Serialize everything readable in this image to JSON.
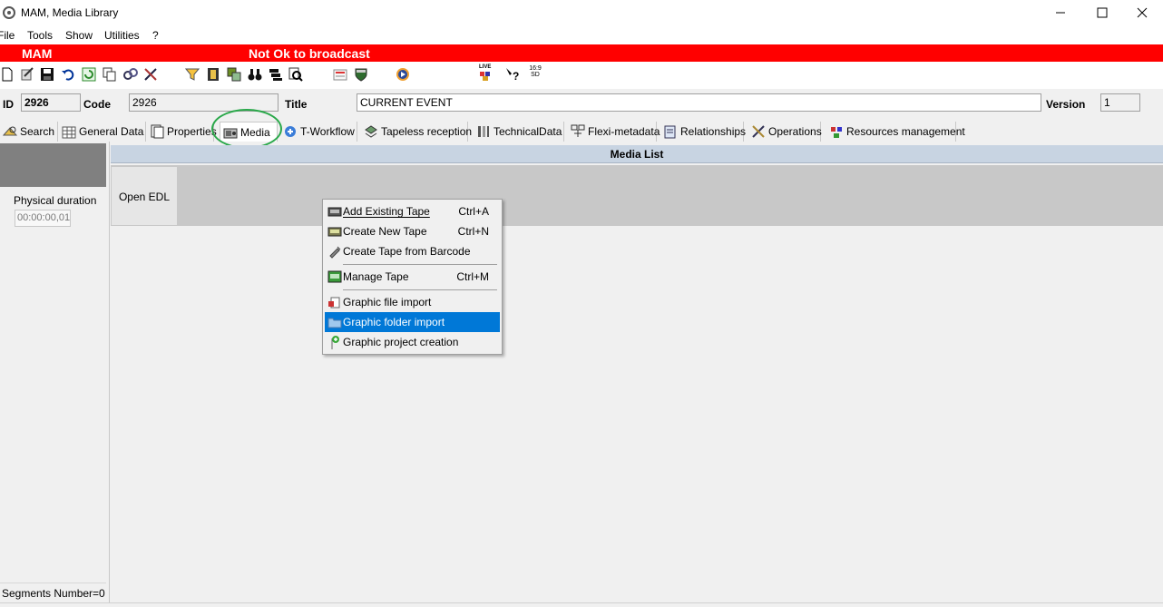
{
  "window": {
    "title": "MAM, Media Library",
    "controls": [
      "minimize-icon",
      "maximize-icon",
      "close-icon"
    ]
  },
  "menubar": {
    "items": [
      "File",
      "Tools",
      "Show",
      "Utilities",
      "?"
    ]
  },
  "banner": {
    "app": "MAM",
    "status": "Not Ok to broadcast",
    "color": "#ff0000"
  },
  "toolbar": {
    "icons": [
      "new-icon",
      "edit-icon",
      "save-icon",
      "undo-icon",
      "refresh-icon",
      "copy-icon",
      "link-icon",
      "tools-icon",
      "filter-icon",
      "film-icon",
      "layers-icon",
      "binoculars-icon",
      "stack-icon",
      "search-icon",
      "abc-icon",
      "shield-icon",
      "play-icon",
      "live-icon",
      "help-icon",
      "aspect-169-icon"
    ],
    "live_label": "LIVE",
    "aspect_label": "16:9 SD"
  },
  "record": {
    "id_label": "ID",
    "id_value": "2926",
    "code_label": "Code",
    "code_value": "2926",
    "title_label": "Title",
    "title_value": "CURRENT EVENT",
    "version_label": "Version",
    "version_value": "1"
  },
  "tabs": [
    {
      "label": "Search",
      "icon": "search-icon"
    },
    {
      "label": "General Data",
      "icon": "grid-icon"
    },
    {
      "label": "Properties",
      "icon": "doc-icon"
    },
    {
      "label": "Media",
      "icon": "media-icon",
      "active": true
    },
    {
      "label": "T-Workflow",
      "icon": "workflow-icon"
    },
    {
      "label": "Tapeless reception",
      "icon": "reception-icon"
    },
    {
      "label": "TechnicalData",
      "icon": "technical-icon"
    },
    {
      "label": "Flexi-metadata",
      "icon": "flexi-icon"
    },
    {
      "label": "Relationships",
      "icon": "relationship-icon"
    },
    {
      "label": "Operations",
      "icon": "operations-icon"
    },
    {
      "label": "Resources management",
      "icon": "resources-icon"
    }
  ],
  "left_panel": {
    "physical_duration_label": "Physical duration",
    "physical_duration_value": "00:00:00,01",
    "segments_label": "Segments Number=0"
  },
  "media_list": {
    "header": "Media List",
    "open_edl_label": "Open EDL"
  },
  "context_menu": {
    "items": [
      {
        "label": "Add Existing Tape",
        "shortcut": "Ctrl+A",
        "icon": "tape-icon"
      },
      {
        "label": "Create New Tape",
        "shortcut": "Ctrl+N",
        "icon": "new-tape-icon"
      },
      {
        "label": "Create Tape from Barcode",
        "shortcut": "",
        "icon": "barcode-icon"
      },
      {
        "label": "Manage Tape",
        "shortcut": "Ctrl+M",
        "icon": "manage-tape-icon"
      },
      {
        "label": "Graphic file import",
        "shortcut": "",
        "icon": "file-import-icon"
      },
      {
        "label": "Graphic folder import",
        "shortcut": "",
        "icon": "folder-icon",
        "selected": true
      },
      {
        "label": "Graphic project creation",
        "shortcut": "",
        "icon": "project-icon"
      }
    ],
    "selection_color": "#0078d7"
  }
}
